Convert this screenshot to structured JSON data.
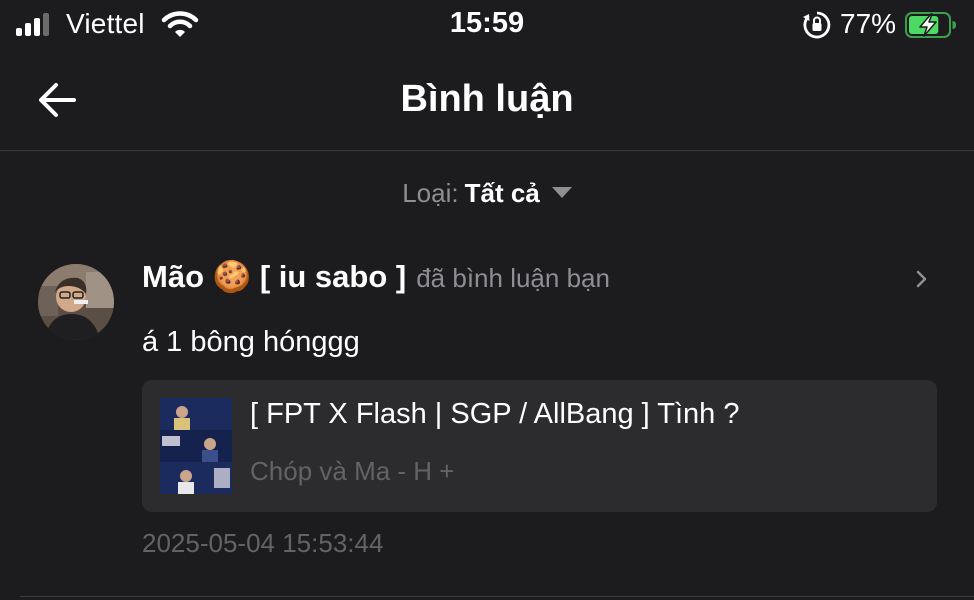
{
  "status_bar": {
    "carrier": "Viettel",
    "time": "15:59",
    "battery_percent": "77%",
    "battery_level": 0.77,
    "charging": true,
    "icons": [
      "signal-icon",
      "wifi-icon",
      "rotation-lock-icon",
      "battery-icon"
    ]
  },
  "nav": {
    "title": "Bình luận",
    "back_icon": "back-arrow-icon"
  },
  "filter": {
    "label": "Loại:",
    "value": "Tất cả",
    "caret_icon": "caret-down-icon"
  },
  "comment": {
    "username": "Mão 🍪 [ iu sabo ]",
    "action": "đã bình luận bạn",
    "text": "á 1 bông hónggg",
    "timestamp": "2025-05-04 15:53:44",
    "post": {
      "title": "[ FPT X Flash | SGP / AllBang ] Tình ?",
      "subtitle": "Chóp và Ma - H +"
    }
  },
  "colors": {
    "background": "#1c1c1e",
    "card": "#2c2c2e",
    "secondary_text": "#8e8e93",
    "tertiary_text": "#636366",
    "battery_green": "#4cd964"
  }
}
